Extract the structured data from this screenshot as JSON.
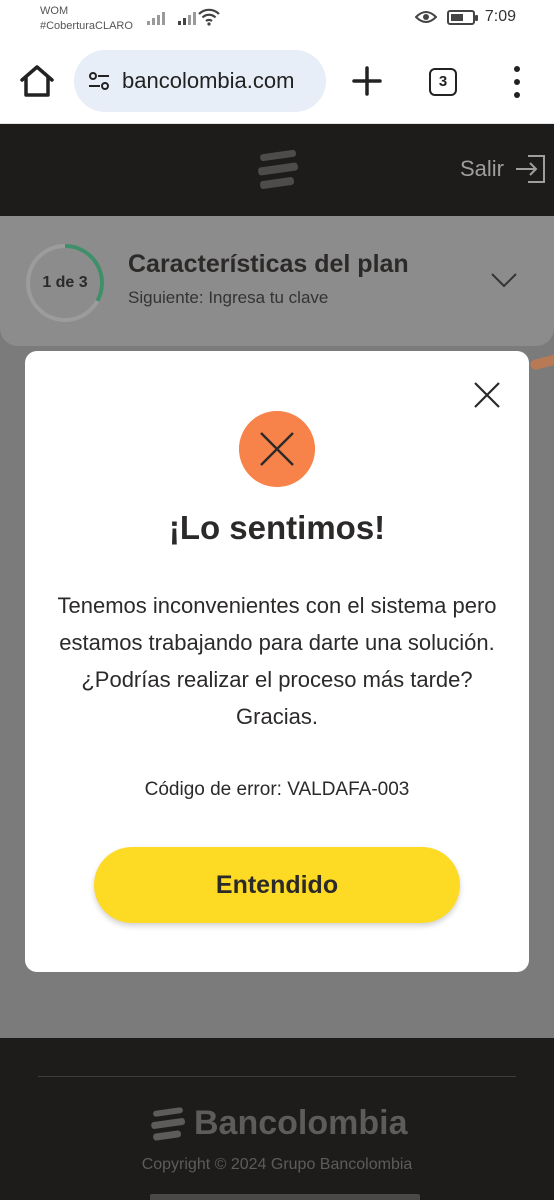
{
  "status_bar": {
    "carrier_line1": "WOM",
    "carrier_line2": "#CoberturaCLARO",
    "time": "7:09",
    "battery_level": 0.6
  },
  "browser": {
    "url": "bancolombia.com",
    "tab_count": "3"
  },
  "site_header": {
    "exit_label": "Salir"
  },
  "step_card": {
    "progress_label": "1 de 3",
    "progress_fraction": 0.33,
    "title": "Características del plan",
    "subtitle": "Siguiente: Ingresa tu clave"
  },
  "modal": {
    "title": "¡Lo sentimos!",
    "message": "Tenemos inconvenientes con el sistema pero estamos trabajando para darte una solución. ¿Podrías realizar el proceso más tarde? Gracias.",
    "error_code": "Código de error: VALDAFA-003",
    "button_label": "Entendido"
  },
  "footer": {
    "brand": "Bancolombia",
    "copyright": "Copyright © 2024 Grupo Bancolombia"
  },
  "colors": {
    "brand_yellow": "#fdda24",
    "error_orange": "#f7834a",
    "dark": "#1d1c1b",
    "progress_green": "#3f8f6a"
  }
}
